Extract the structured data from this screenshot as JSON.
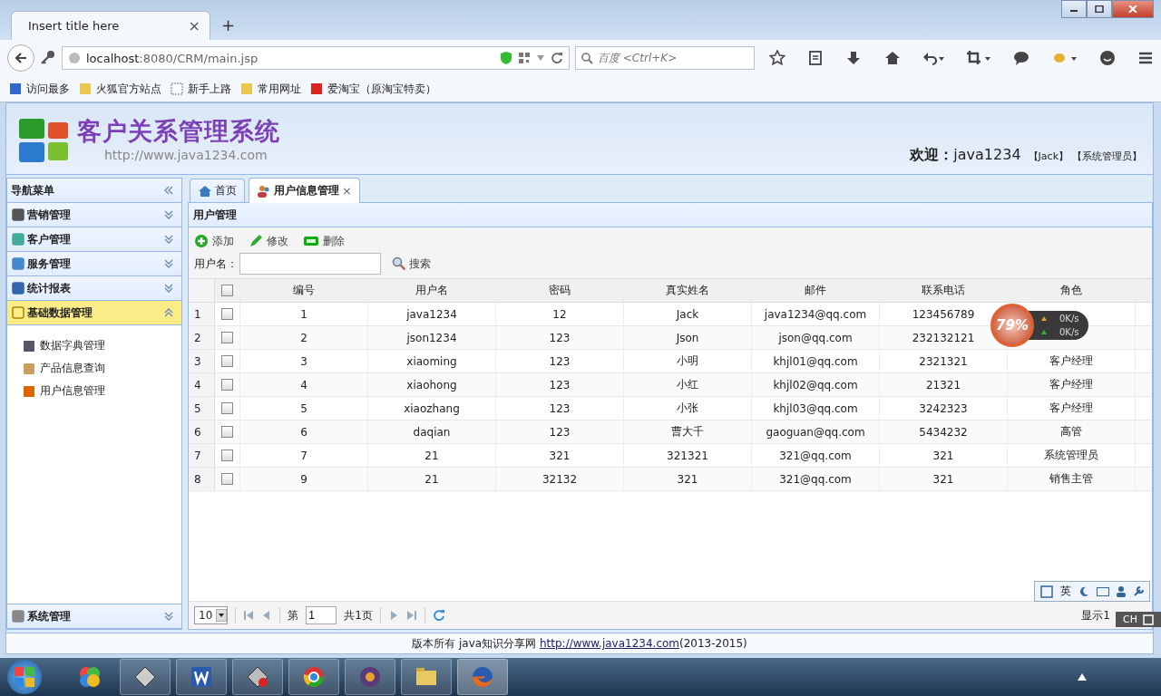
{
  "browser": {
    "tab_title": "Insert title here",
    "tab_close": "×",
    "new_tab": "+",
    "url_host": "localhost",
    "url_rest": ":8080/CRM/main.jsp",
    "search_placeholder": "百度 <Ctrl+K>",
    "bookmarks": [
      {
        "label": "访问最多",
        "kind": "page"
      },
      {
        "label": "火狐官方站点",
        "kind": "folder"
      },
      {
        "label": "新手上路",
        "kind": "dashed"
      },
      {
        "label": "常用网址",
        "kind": "folder"
      },
      {
        "label": "爱淘宝（原淘宝特卖）",
        "kind": "taobao"
      }
    ]
  },
  "header": {
    "title": "客户关系管理系统",
    "url": "http://www.java1234.com",
    "welcome_label": "欢迎：",
    "user": "java1234",
    "name": "【Jack】",
    "role": "【系统管理员】"
  },
  "sidebar": {
    "title": "导航菜单",
    "sections": [
      {
        "label": "营销管理",
        "expanded": false
      },
      {
        "label": "客户管理",
        "expanded": false
      },
      {
        "label": "服务管理",
        "expanded": false
      },
      {
        "label": "统计报表",
        "expanded": false
      },
      {
        "label": "基础数据管理",
        "expanded": true,
        "children": [
          {
            "label": "数据字典管理"
          },
          {
            "label": "产品信息查询"
          },
          {
            "label": "用户信息管理"
          }
        ]
      },
      {
        "label": "系统管理",
        "expanded": false
      }
    ]
  },
  "tabs": [
    {
      "label": "首页",
      "selected": false
    },
    {
      "label": "用户信息管理",
      "selected": true,
      "close": "×"
    }
  ],
  "panel": {
    "title": "用户管理",
    "toolbar": [
      {
        "label": "添加",
        "kind": "add"
      },
      {
        "label": "修改",
        "kind": "edit"
      },
      {
        "label": "删除",
        "kind": "remove"
      }
    ],
    "search_label": "用户名：",
    "search_button": "搜索"
  },
  "table": {
    "all_checked": false,
    "columns": [
      "编号",
      "用户名",
      "密码",
      "真实姓名",
      "邮件",
      "联系电话",
      "角色"
    ],
    "rows": [
      {
        "num": "1",
        "checked": false,
        "cells": [
          "1",
          "java1234",
          "12",
          "Jack",
          "java1234@qq.com",
          "123456789"
        ]
      },
      {
        "num": "2",
        "checked": false,
        "cells": [
          "2",
          "json1234",
          "123",
          "Json",
          "json@qq.com",
          "232132121"
        ]
      },
      {
        "num": "3",
        "checked": false,
        "cells": [
          "3",
          "xiaoming",
          "123",
          "小明",
          "khjl01@qq.com",
          "2321321",
          "客户经理"
        ]
      },
      {
        "num": "4",
        "checked": false,
        "cells": [
          "4",
          "xiaohong",
          "123",
          "小红",
          "khjl02@qq.com",
          "21321",
          "客户经理"
        ]
      },
      {
        "num": "5",
        "checked": false,
        "cells": [
          "5",
          "xiaozhang",
          "123",
          "小张",
          "khjl03@qq.com",
          "3242323",
          "客户经理"
        ]
      },
      {
        "num": "6",
        "checked": false,
        "cells": [
          "6",
          "daqian",
          "123",
          "曹大千",
          "gaoguan@qq.com",
          "5434232",
          "高管"
        ]
      },
      {
        "num": "7",
        "checked": false,
        "cells": [
          "7",
          "21",
          "321",
          "321321",
          "321@qq.com",
          "321",
          "系统管理员"
        ]
      },
      {
        "num": "8",
        "checked": false,
        "cells": [
          "9",
          "21",
          "32132",
          "321",
          "321@qq.com",
          "321",
          "销售主管"
        ]
      }
    ]
  },
  "pager": {
    "page_size": "10",
    "page_prefix": "第",
    "page": "1",
    "page_total": "共1页",
    "display": "显示1"
  },
  "footer": {
    "before": "版本所有 java知识分享网 ",
    "link": "http://www.java1234.com",
    "after": "(2013-2015)"
  },
  "monitor": {
    "percent": "79%",
    "up": "0K/s",
    "down": "0K/s"
  },
  "ime": {
    "lang": "英",
    "tray": "CH"
  }
}
